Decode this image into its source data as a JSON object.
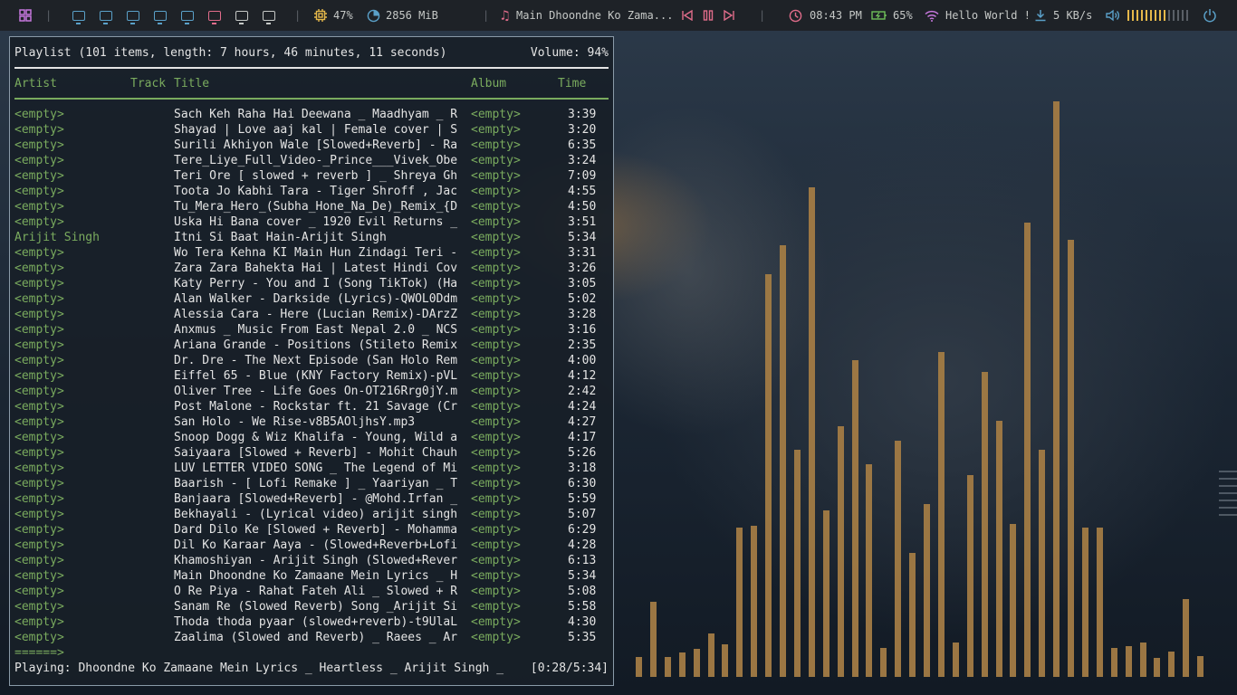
{
  "topbar": {
    "workspaces_count": 8,
    "active_workspace": 6,
    "cpu": "47%",
    "memory": "2856 MiB",
    "now_playing": "Main Dhoondne Ko Zama...",
    "time": "08:43 PM",
    "battery": "65%",
    "wifi": "Hello World !",
    "net_speed": "5 KB/s",
    "volume_level": 0.65,
    "colors": {
      "cpu": "#e5b84a",
      "memory": "#5aa0c8",
      "music": "#e06c8a",
      "clock": "#e06c8a",
      "battery": "#6fbf5a",
      "wifi": "#c678dd",
      "download": "#5aa0c8",
      "volume": "#5aa0c8",
      "power": "#5aa0c8"
    }
  },
  "playlist": {
    "header": "Playlist (101 items, length: 7 hours, 46 minutes, 11 seconds)",
    "volume": "Volume: 94%",
    "columns": {
      "artist": "Artist",
      "track": "Track",
      "title": "Title",
      "album": "Album",
      "time": "Time"
    },
    "rows": [
      {
        "artist": "<empty>",
        "title": "Sach Keh Raha Hai Deewana _ Maadhyam _ R",
        "album": "<empty>",
        "time": "3:39"
      },
      {
        "artist": "<empty>",
        "title": "Shayad | Love aaj kal | Female cover | S",
        "album": "<empty>",
        "time": "3:20"
      },
      {
        "artist": "<empty>",
        "title": "Surili Akhiyon Wale [Slowed+Reverb] - Ra",
        "album": "<empty>",
        "time": "6:35"
      },
      {
        "artist": "<empty>",
        "title": "Tere_Liye_Full_Video-_Prince___Vivek_Obe",
        "album": "<empty>",
        "time": "3:24"
      },
      {
        "artist": "<empty>",
        "title": "Teri Ore [ slowed + reverb ] _ Shreya Gh",
        "album": "<empty>",
        "time": "7:09"
      },
      {
        "artist": "<empty>",
        "title": "Toota Jo Kabhi Tara - Tiger Shroff , Jac",
        "album": "<empty>",
        "time": "4:55"
      },
      {
        "artist": "<empty>",
        "title": "Tu_Mera_Hero_(Subha_Hone_Na_De)_Remix_{D",
        "album": "<empty>",
        "time": "4:50"
      },
      {
        "artist": "<empty>",
        "title": "Uska Hi Bana cover _ 1920 Evil Returns _",
        "album": "<empty>",
        "time": "3:51"
      },
      {
        "artist": "Arijit Singh",
        "title": "Itni Si Baat Hain-Arijit Singh",
        "album": "<empty>",
        "time": "5:34"
      },
      {
        "artist": "<empty>",
        "title": "Wo Tera Kehna KI Main Hun Zindagi Teri -",
        "album": "<empty>",
        "time": "3:31"
      },
      {
        "artist": "<empty>",
        "title": "Zara Zara Bahekta Hai | Latest Hindi Cov",
        "album": "<empty>",
        "time": "3:26"
      },
      {
        "artist": "<empty>",
        "title": "Katy Perry - You and I (Song TikTok) (Ha",
        "album": "<empty>",
        "time": "3:05"
      },
      {
        "artist": "<empty>",
        "title": "Alan Walker - Darkside (Lyrics)-QWOL0Ddm",
        "album": "<empty>",
        "time": "5:02"
      },
      {
        "artist": "<empty>",
        "title": "Alessia Cara - Here (Lucian Remix)-DArzZ",
        "album": "<empty>",
        "time": "3:28"
      },
      {
        "artist": "<empty>",
        "title": "Anxmus _ Music From East Nepal 2.0 _ NCS",
        "album": "<empty>",
        "time": "3:16"
      },
      {
        "artist": "<empty>",
        "title": "Ariana Grande - Positions (Stileto Remix",
        "album": "<empty>",
        "time": "2:35"
      },
      {
        "artist": "<empty>",
        "title": "Dr. Dre - The Next Episode (San Holo Rem",
        "album": "<empty>",
        "time": "4:00"
      },
      {
        "artist": "<empty>",
        "title": "Eiffel 65 - Blue (KNY Factory Remix)-pVL",
        "album": "<empty>",
        "time": "4:12"
      },
      {
        "artist": "<empty>",
        "title": "Oliver Tree - Life Goes On-OT216Rrg0jY.m",
        "album": "<empty>",
        "time": "2:42"
      },
      {
        "artist": "<empty>",
        "title": "Post Malone - Rockstar ft. 21 Savage (Cr",
        "album": "<empty>",
        "time": "4:24"
      },
      {
        "artist": "<empty>",
        "title": "San Holo - We Rise-v8B5AOljhsY.mp3",
        "album": "<empty>",
        "time": "4:27"
      },
      {
        "artist": "<empty>",
        "title": "Snoop Dogg & Wiz Khalifa - Young, Wild a",
        "album": "<empty>",
        "time": "4:17"
      },
      {
        "artist": "<empty>",
        "title": "Saiyaara [Slowed + Reverb] - Mohit Chauh",
        "album": "<empty>",
        "time": "5:26"
      },
      {
        "artist": "<empty>",
        "title": "LUV LETTER VIDEO SONG _ The Legend of Mi",
        "album": "<empty>",
        "time": "3:18"
      },
      {
        "artist": "<empty>",
        "title": "Baarish - [ Lofi Remake ] _ Yaariyan _ T",
        "album": "<empty>",
        "time": "6:30"
      },
      {
        "artist": "<empty>",
        "title": "Banjaara [Slowed+Reverb] - @Mohd.Irfan _",
        "album": "<empty>",
        "time": "5:59"
      },
      {
        "artist": "<empty>",
        "title": "Bekhayali - (Lyrical video) arijit singh",
        "album": "<empty>",
        "time": "5:07"
      },
      {
        "artist": "<empty>",
        "title": "Dard Dilo Ke [Slowed + Reverb] - Mohamma",
        "album": "<empty>",
        "time": "6:29"
      },
      {
        "artist": "<empty>",
        "title": "Dil Ko Karaar Aaya - (Slowed+Reverb+Lofi",
        "album": "<empty>",
        "time": "4:28"
      },
      {
        "artist": "<empty>",
        "title": "Khamoshiyan - Arijit Singh (Slowed+Rever",
        "album": "<empty>",
        "time": "6:13"
      },
      {
        "artist": "<empty>",
        "title": "Main Dhoondne Ko Zamaane Mein Lyrics _ H",
        "album": "<empty>",
        "time": "5:34"
      },
      {
        "artist": "<empty>",
        "title": "O Re Piya - Rahat Fateh Ali _ Slowed + R",
        "album": "<empty>",
        "time": "5:08"
      },
      {
        "artist": "<empty>",
        "title": "Sanam Re (Slowed Reverb) Song _Arijit Si",
        "album": "<empty>",
        "time": "5:58"
      },
      {
        "artist": "<empty>",
        "title": "Thoda thoda pyaar (slowed+reverb)-t9UlaL",
        "album": "<empty>",
        "time": "4:30"
      },
      {
        "artist": "<empty>",
        "title": "Zaalima (Slowed and Reverb) _ Raees _ Ar",
        "album": "<empty>",
        "time": "5:35"
      }
    ],
    "progress_bar": "======>",
    "playing": "Playing: Dhoondne Ko Zamaane Mein Lyrics _ Heartless _ Arijit Singh _",
    "position": "[0:28/5:34]"
  },
  "visualizer": {
    "bar_color": "#a27b45",
    "levels": [
      0.035,
      0.13,
      0.035,
      0.043,
      0.049,
      0.075,
      0.057,
      0.26,
      0.263,
      0.7,
      0.75,
      0.395,
      0.85,
      0.29,
      0.435,
      0.55,
      0.37,
      0.05,
      0.41,
      0.215,
      0.3,
      0.565,
      0.06,
      0.35,
      0.53,
      0.445,
      0.265,
      0.79,
      0.395,
      1.0,
      0.76,
      0.26,
      0.26,
      0.05,
      0.053,
      0.059,
      0.033,
      0.044,
      0.135,
      0.036
    ]
  }
}
